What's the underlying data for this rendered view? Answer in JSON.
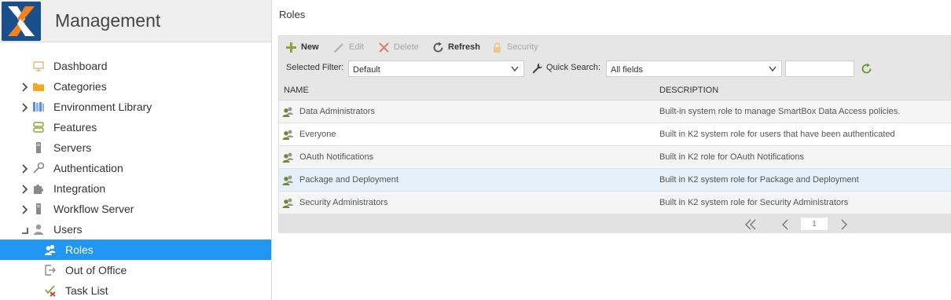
{
  "app": {
    "title": "Management",
    "logo_icon": "k2-x-logo",
    "accent_color": "#2196f3"
  },
  "sidebar": {
    "items": [
      {
        "label": "Dashboard",
        "icon": "dashboard-icon",
        "expander": "none",
        "selected": false
      },
      {
        "label": "Categories",
        "icon": "folder-icon",
        "expander": "collapsed",
        "selected": false
      },
      {
        "label": "Environment Library",
        "icon": "library-icon",
        "expander": "collapsed",
        "selected": false
      },
      {
        "label": "Features",
        "icon": "features-icon",
        "expander": "none",
        "selected": false
      },
      {
        "label": "Servers",
        "icon": "server-icon",
        "expander": "none",
        "selected": false
      },
      {
        "label": "Authentication",
        "icon": "key-icon",
        "expander": "collapsed",
        "selected": false
      },
      {
        "label": "Integration",
        "icon": "puzzle-icon",
        "expander": "collapsed",
        "selected": false
      },
      {
        "label": "Workflow Server",
        "icon": "server-icon",
        "expander": "collapsed",
        "selected": false
      },
      {
        "label": "Users",
        "icon": "user-icon",
        "expander": "expanded",
        "selected": false
      },
      {
        "label": "Roles",
        "icon": "roles-icon",
        "expander": "child",
        "selected": true
      },
      {
        "label": "Out of Office",
        "icon": "out-of-office-icon",
        "expander": "child",
        "selected": false
      },
      {
        "label": "Task List",
        "icon": "task-list-icon",
        "expander": "child",
        "selected": false
      }
    ]
  },
  "main": {
    "title": "Roles",
    "toolbar": {
      "new_label": "New",
      "edit_label": "Edit",
      "delete_label": "Delete",
      "refresh_label": "Refresh",
      "security_label": "Security"
    },
    "filter": {
      "selected_filter_label": "Selected Filter:",
      "selected_filter_value": "Default",
      "quick_search_label": "Quick Search:",
      "quick_search_field": "All fields",
      "quick_search_value": ""
    },
    "table": {
      "columns": [
        "NAME",
        "DESCRIPTION"
      ],
      "rows": [
        {
          "name": "Data Administrators",
          "description": "Built-in system role to manage SmartBox Data Access policies."
        },
        {
          "name": "Everyone",
          "description": "Built in K2 system role for users that have been authenticated"
        },
        {
          "name": "OAuth Notifications",
          "description": "Built in K2 role for OAuth Notifications"
        },
        {
          "name": "Package and Deployment",
          "description": "Built in K2 system role for Package and Deployment"
        },
        {
          "name": "Security Administrators",
          "description": "Built in K2 system role for Security Administrators"
        }
      ]
    },
    "pager": {
      "page": "1"
    }
  }
}
